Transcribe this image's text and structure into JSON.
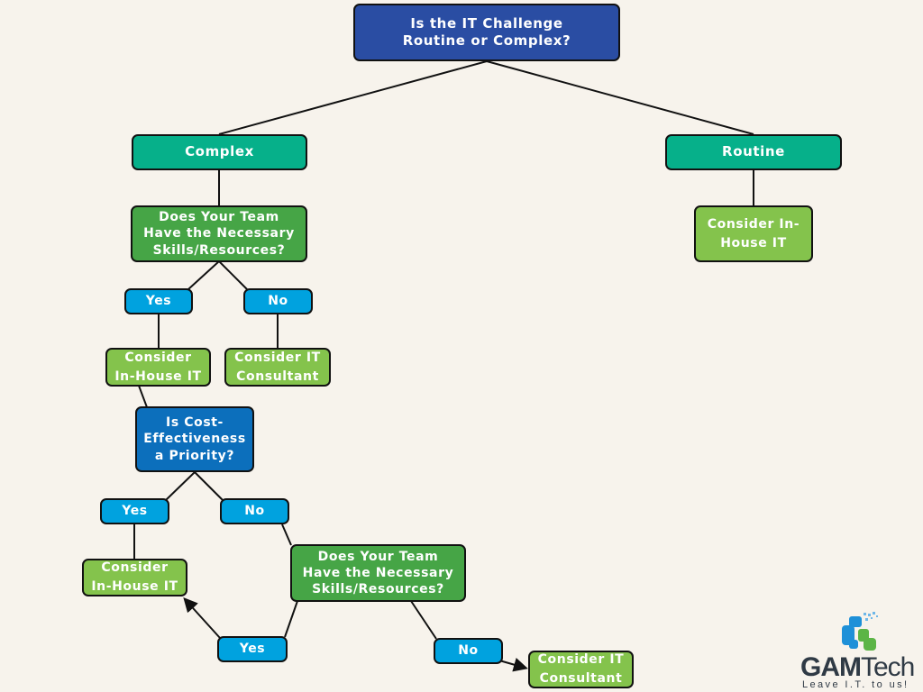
{
  "nodes": {
    "root": "Is the IT Challenge\nRoutine or Complex?",
    "complex": "Complex",
    "routine": "Routine",
    "routine_result": "Consider In-\nHouse IT",
    "skills_q1": "Does Your Team\nHave the Necessary\nSkills/Resources?",
    "q1_yes": "Yes",
    "q1_no": "No",
    "q1_yes_result": "Consider\nIn-House IT",
    "q1_no_result": "Consider IT\nConsultant",
    "cost_q": "Is Cost-\nEffectiveness\na Priority?",
    "cost_yes": "Yes",
    "cost_no": "No",
    "cost_yes_result": "Consider\nIn-House IT",
    "skills_q2": "Does Your Team\nHave the Necessary\nSkills/Resources?",
    "q2_yes": "Yes",
    "q2_no": "No",
    "q2_no_result": "Consider IT\nConsultant"
  },
  "logo": {
    "brand_bold": "GAM",
    "brand_light": "Tech",
    "tagline": "Leave I.T. to us!"
  },
  "colors": {
    "background": "#f7f3ec",
    "question_main": "#2a4da3",
    "branch": "#06b08a",
    "question_green": "#46a546",
    "question_blue": "#0c6fbc",
    "answer": "#00a2df",
    "result": "#84c34c"
  }
}
